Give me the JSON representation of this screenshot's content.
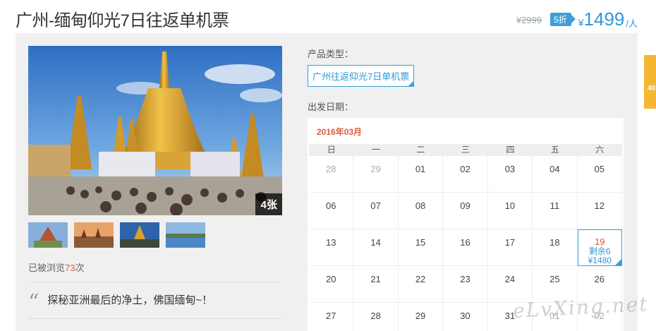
{
  "page": {
    "title": "广州-缅甸仰光7日往返单机票",
    "original_price": "¥2999",
    "discount": "5折",
    "currency": "¥",
    "price": "1499",
    "unit": "/人"
  },
  "gallery": {
    "photo_count": "4张",
    "thumbnails": [
      "bagan-temple",
      "bagan-pagodas",
      "golden-temple",
      "inle-lake"
    ]
  },
  "views": {
    "prefix": "已被浏览",
    "count": "73",
    "suffix": "次"
  },
  "slogan": {
    "quote": "“",
    "text": "探秘亚洲最后的净土，佛国缅甸~！"
  },
  "product": {
    "label": "产品类型：",
    "selected": "广州往返仰光7日单机票"
  },
  "departure": {
    "label": "出发日期："
  },
  "calendar": {
    "month": "2016年03月",
    "weekdays": [
      "日",
      "一",
      "二",
      "三",
      "四",
      "五",
      "六"
    ],
    "cells": [
      {
        "day": "28",
        "prev": true
      },
      {
        "day": "29",
        "prev": true
      },
      {
        "day": "01"
      },
      {
        "day": "02"
      },
      {
        "day": "03"
      },
      {
        "day": "04"
      },
      {
        "day": "05"
      },
      {
        "day": "06"
      },
      {
        "day": "07"
      },
      {
        "day": "08"
      },
      {
        "day": "09"
      },
      {
        "day": "10"
      },
      {
        "day": "11"
      },
      {
        "day": "12"
      },
      {
        "day": "13"
      },
      {
        "day": "14"
      },
      {
        "day": "15"
      },
      {
        "day": "16"
      },
      {
        "day": "17"
      },
      {
        "day": "18"
      },
      {
        "day": "19",
        "selected": true,
        "stock": "剩余6",
        "price": "¥1480"
      },
      {
        "day": "20"
      },
      {
        "day": "21"
      },
      {
        "day": "22"
      },
      {
        "day": "23"
      },
      {
        "day": "24"
      },
      {
        "day": "25"
      },
      {
        "day": "26"
      },
      {
        "day": "27"
      },
      {
        "day": "28"
      },
      {
        "day": "29"
      },
      {
        "day": "30"
      },
      {
        "day": "31"
      },
      {
        "day": "01",
        "prev": true
      },
      {
        "day": "02",
        "prev": true
      }
    ]
  },
  "side_tab": {
    "text": "40"
  },
  "watermark": {
    "text": "eLvXing.net"
  },
  "colors": {
    "accent": "#2f98d6",
    "red": "#e05a3c",
    "tab": "#f5b732"
  }
}
